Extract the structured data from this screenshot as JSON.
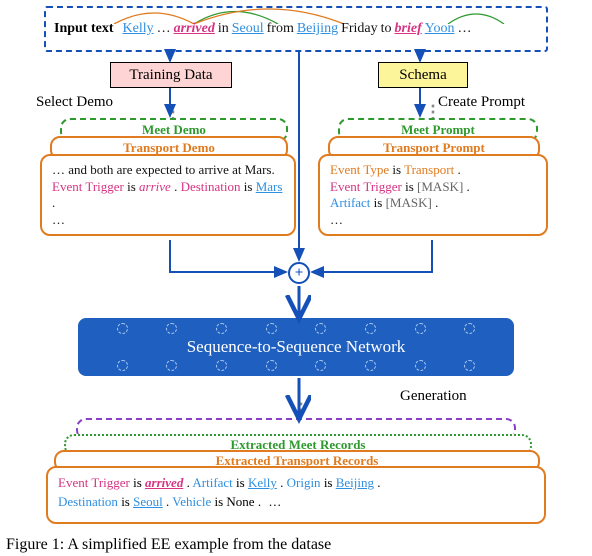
{
  "input": {
    "label": "Input text",
    "tokens": {
      "kelly": "Kelly",
      "ellipsis1": "…",
      "arrived": "arrived",
      "in": "in",
      "seoul": "Seoul",
      "from": "from",
      "beijing": "Beijing",
      "friday": "Friday",
      "to": "to",
      "brief": "brief",
      "yoon": "Yoon",
      "ellipsis2": "…"
    }
  },
  "boxes": {
    "training_data": "Training Data",
    "schema": "Schema"
  },
  "labels": {
    "select_demo": "Select Demo",
    "create_prompt": "Create Prompt",
    "generation": "Generation"
  },
  "demos": {
    "meet_header": "Meet Demo",
    "transport_header": "Transport Demo",
    "body_pre": "… and both are expected to arrive at Mars. ",
    "body_et_label": "Event Trigger ",
    "body_et_is": "is ",
    "body_trigger": "arrive",
    "body_period1": ". ",
    "body_dest_label": "Destination ",
    "body_dest_is": "is ",
    "body_dest_value": "Mars",
    "body_period2": ".",
    "ellipsis": "…"
  },
  "prompts": {
    "meet_header": "Meet Prompt",
    "transport_header": "Transport Prompt",
    "line1_key": "Event Type ",
    "line1_is": "is ",
    "line1_val": "Transport",
    "line1_end": ".",
    "line2_key": "Event Trigger ",
    "line2_is": "is ",
    "line2_val": "[MASK]",
    "line2_end": ".",
    "line3_key": "Artifact ",
    "line3_is": "is ",
    "line3_val": "[MASK]",
    "line3_end": ".",
    "ellipsis": "…"
  },
  "plus": "+",
  "s2s": {
    "label": "Sequence-to-Sequence Network"
  },
  "output": {
    "meet_header": "Extracted Meet Records",
    "transport_header": "Extracted Transport Records",
    "r_trig_label": "Event Trigger ",
    "r_trig_is": "is ",
    "r_trig_val": "arrived",
    "r_art_label": " Artifact ",
    "r_art_is": "is ",
    "r_art_val": "Kelly",
    "r_org_label": " Origin ",
    "r_org_is": "is ",
    "r_org_val": "Beijing",
    "r_dest_label": "Destination ",
    "r_dest_is": "is ",
    "r_dest_val": "Seoul",
    "r_veh_label": " Vehicle ",
    "r_veh_is": "is ",
    "r_veh_val": "None",
    "period": ".",
    "ellipsis": "…"
  },
  "caption": "Figure 1: A simplified EE example from the datase"
}
